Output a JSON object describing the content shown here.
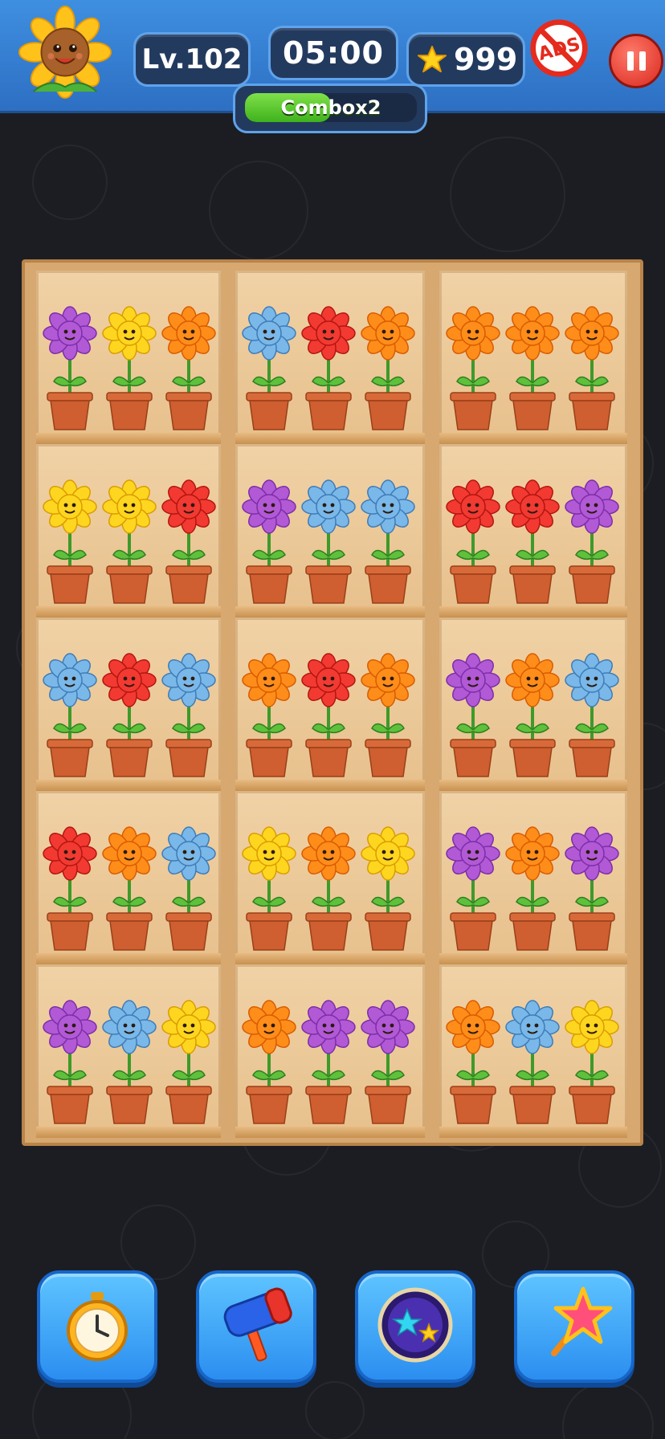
{
  "header": {
    "level": "Lv.102",
    "timer": "05:00",
    "stars": "999",
    "combo_label": "Combox2",
    "combo_progress": 0.5,
    "ads_label": "ADS"
  },
  "colors": {
    "purple": "#b259d6",
    "yellow": "#ffd61f",
    "orange": "#ff8d1a",
    "blue": "#79b8e8",
    "red": "#f23a32"
  },
  "shelf": {
    "columns": 3,
    "rows": 5,
    "cells": [
      [
        "purple",
        "yellow",
        "orange"
      ],
      [
        "blue",
        "red",
        "orange"
      ],
      [
        "orange",
        "orange",
        "orange"
      ],
      [
        "yellow",
        "yellow",
        "red"
      ],
      [
        "purple",
        "blue",
        "blue"
      ],
      [
        "red",
        "red",
        "purple"
      ],
      [
        "blue",
        "red",
        "blue"
      ],
      [
        "orange",
        "red",
        "orange"
      ],
      [
        "purple",
        "orange",
        "blue"
      ],
      [
        "red",
        "orange",
        "blue"
      ],
      [
        "yellow",
        "orange",
        "yellow"
      ],
      [
        "purple",
        "orange",
        "purple"
      ],
      [
        "purple",
        "blue",
        "yellow"
      ],
      [
        "orange",
        "purple",
        "purple"
      ],
      [
        "orange",
        "blue",
        "yellow"
      ]
    ]
  },
  "boosters": [
    {
      "name": "stopwatch-booster",
      "icon": "stopwatch-icon"
    },
    {
      "name": "hammer-booster",
      "icon": "hammer-icon"
    },
    {
      "name": "portal-booster",
      "icon": "star-portal-icon"
    },
    {
      "name": "magic-wand-booster",
      "icon": "magic-wand-icon"
    }
  ]
}
